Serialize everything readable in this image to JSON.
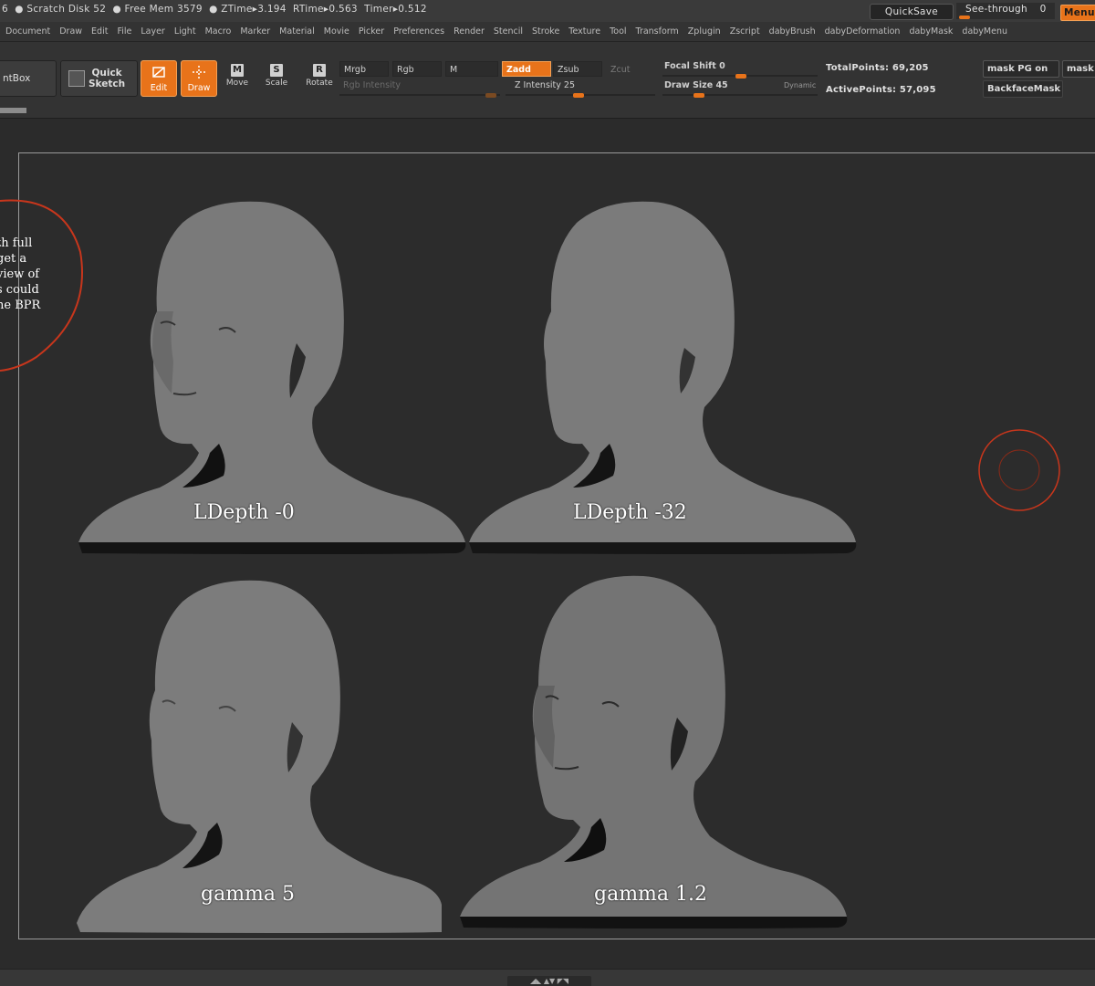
{
  "status": {
    "text": "6  ● Scratch Disk 52  ● Free Mem 3579  ● ZTime▸3.194  RTime▸0.563  Timer▸0.512",
    "quicksave": "QuickSave",
    "see_through_label": "See-through",
    "see_through_value": "0",
    "menus": "Menus"
  },
  "menu": [
    "Document",
    "Draw",
    "Edit",
    "File",
    "Layer",
    "Light",
    "Macro",
    "Marker",
    "Material",
    "Movie",
    "Picker",
    "Preferences",
    "Render",
    "Stencil",
    "Stroke",
    "Texture",
    "Tool",
    "Transform",
    "Zplugin",
    "Zscript",
    "dabyBrush",
    "dabyDeformation",
    "dabyMask",
    "dabyMenu"
  ],
  "toolbar": {
    "lightbox": "ntBox",
    "quick_sketch": "Quick\nSketch",
    "edit": "Edit",
    "draw": "Draw",
    "move": "Move",
    "scale": "Scale",
    "rotate": "Rotate",
    "move_key": "M",
    "scale_key": "S",
    "rotate_key": "R",
    "mrgb": "Mrgb",
    "rgb": "Rgb",
    "m": "M",
    "zadd": "Zadd",
    "zsub": "Zsub",
    "zcut": "Zcut",
    "rgb_intensity": "Rgb  Intensity",
    "z_intensity": "Z  Intensity 25",
    "focal_shift": "Focal  Shift 0",
    "draw_size": "Draw  Size 45",
    "dynamic": "Dynamic",
    "total_points": "TotalPoints: 69,205",
    "active_points": "ActivePoints: 57,095",
    "mask_pg": "mask  PG  on",
    "mask_short": "mask",
    "backface_mask": "BackfaceMask"
  },
  "canvas": {
    "annotation_lines": [
      "th full",
      "get a",
      "view of",
      "s could",
      "he BPR"
    ],
    "renders": [
      {
        "label": "LDepth -0"
      },
      {
        "label": "LDepth -32"
      },
      {
        "label": "gamma 5"
      },
      {
        "label": "gamma 1.2"
      }
    ]
  },
  "colors": {
    "accent": "#e8731a",
    "annotation": "#c8361c"
  },
  "bottom": {
    "handle": "◢◣ ▲▼ ◤◥"
  }
}
